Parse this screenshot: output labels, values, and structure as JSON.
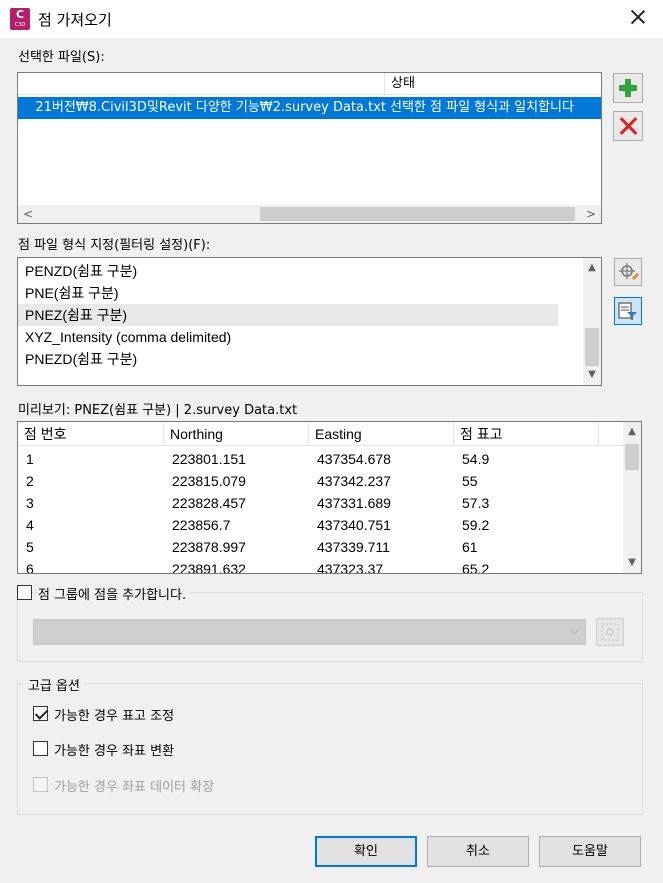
{
  "window": {
    "title": "점 가져오기",
    "app_icon_letter": "C",
    "app_icon_sub": "C3D"
  },
  "files": {
    "label": "선택한 파일(S):",
    "columns": [
      "",
      "상태"
    ],
    "rows": [
      {
        "path": "21버전₩8.Civil3D및Revit 다양한 기능₩2.survey Data.txt",
        "status": "선택한 점 파일 형식과 일치합니다"
      }
    ]
  },
  "formats": {
    "label": "점 파일 형식 지정(필터링 설정)(F):",
    "items": [
      "PENZD(쉼표 구분)",
      "PNE(쉼표 구분)",
      "PNEZ(쉼표 구분)",
      "XYZ_Intensity (comma delimited)",
      "PNEZD(쉼표 구분)"
    ],
    "selected": "PNEZ(쉼표 구분)"
  },
  "preview": {
    "label": "미리보기: PNEZ(쉼표 구분) | 2.survey Data.txt",
    "columns": [
      "점 번호",
      "Northing",
      "Easting",
      "점 표고"
    ],
    "rows": [
      [
        "1",
        "223801.151",
        "437354.678",
        "54.9"
      ],
      [
        "2",
        "223815.079",
        "437342.237",
        "55"
      ],
      [
        "3",
        "223828.457",
        "437331.689",
        "57.3"
      ],
      [
        "4",
        "223856.7",
        "437340.751",
        "59.2"
      ],
      [
        "5",
        "223878.997",
        "437339.711",
        "61"
      ],
      [
        "6",
        "223891.632",
        "437323.37",
        "65.2"
      ]
    ]
  },
  "group": {
    "checkbox_label": "점 그룹에 점을 추가합니다.",
    "checked": false,
    "selected_value": ""
  },
  "advanced": {
    "label": "고급 옵션",
    "options": [
      {
        "label": "가능한 경우 표고 조정",
        "checked": true,
        "enabled": true
      },
      {
        "label": "가능한 경우 좌표 변환",
        "checked": false,
        "enabled": true
      },
      {
        "label": "가능한 경우 좌표 데이터 확장",
        "checked": false,
        "enabled": false
      }
    ]
  },
  "buttons": {
    "ok": "확인",
    "cancel": "취소",
    "help": "도움말"
  },
  "colors": {
    "selection": "#0078d7",
    "add": "#2ea83a",
    "remove": "#e02020",
    "app_icon": "#b21f6b"
  }
}
